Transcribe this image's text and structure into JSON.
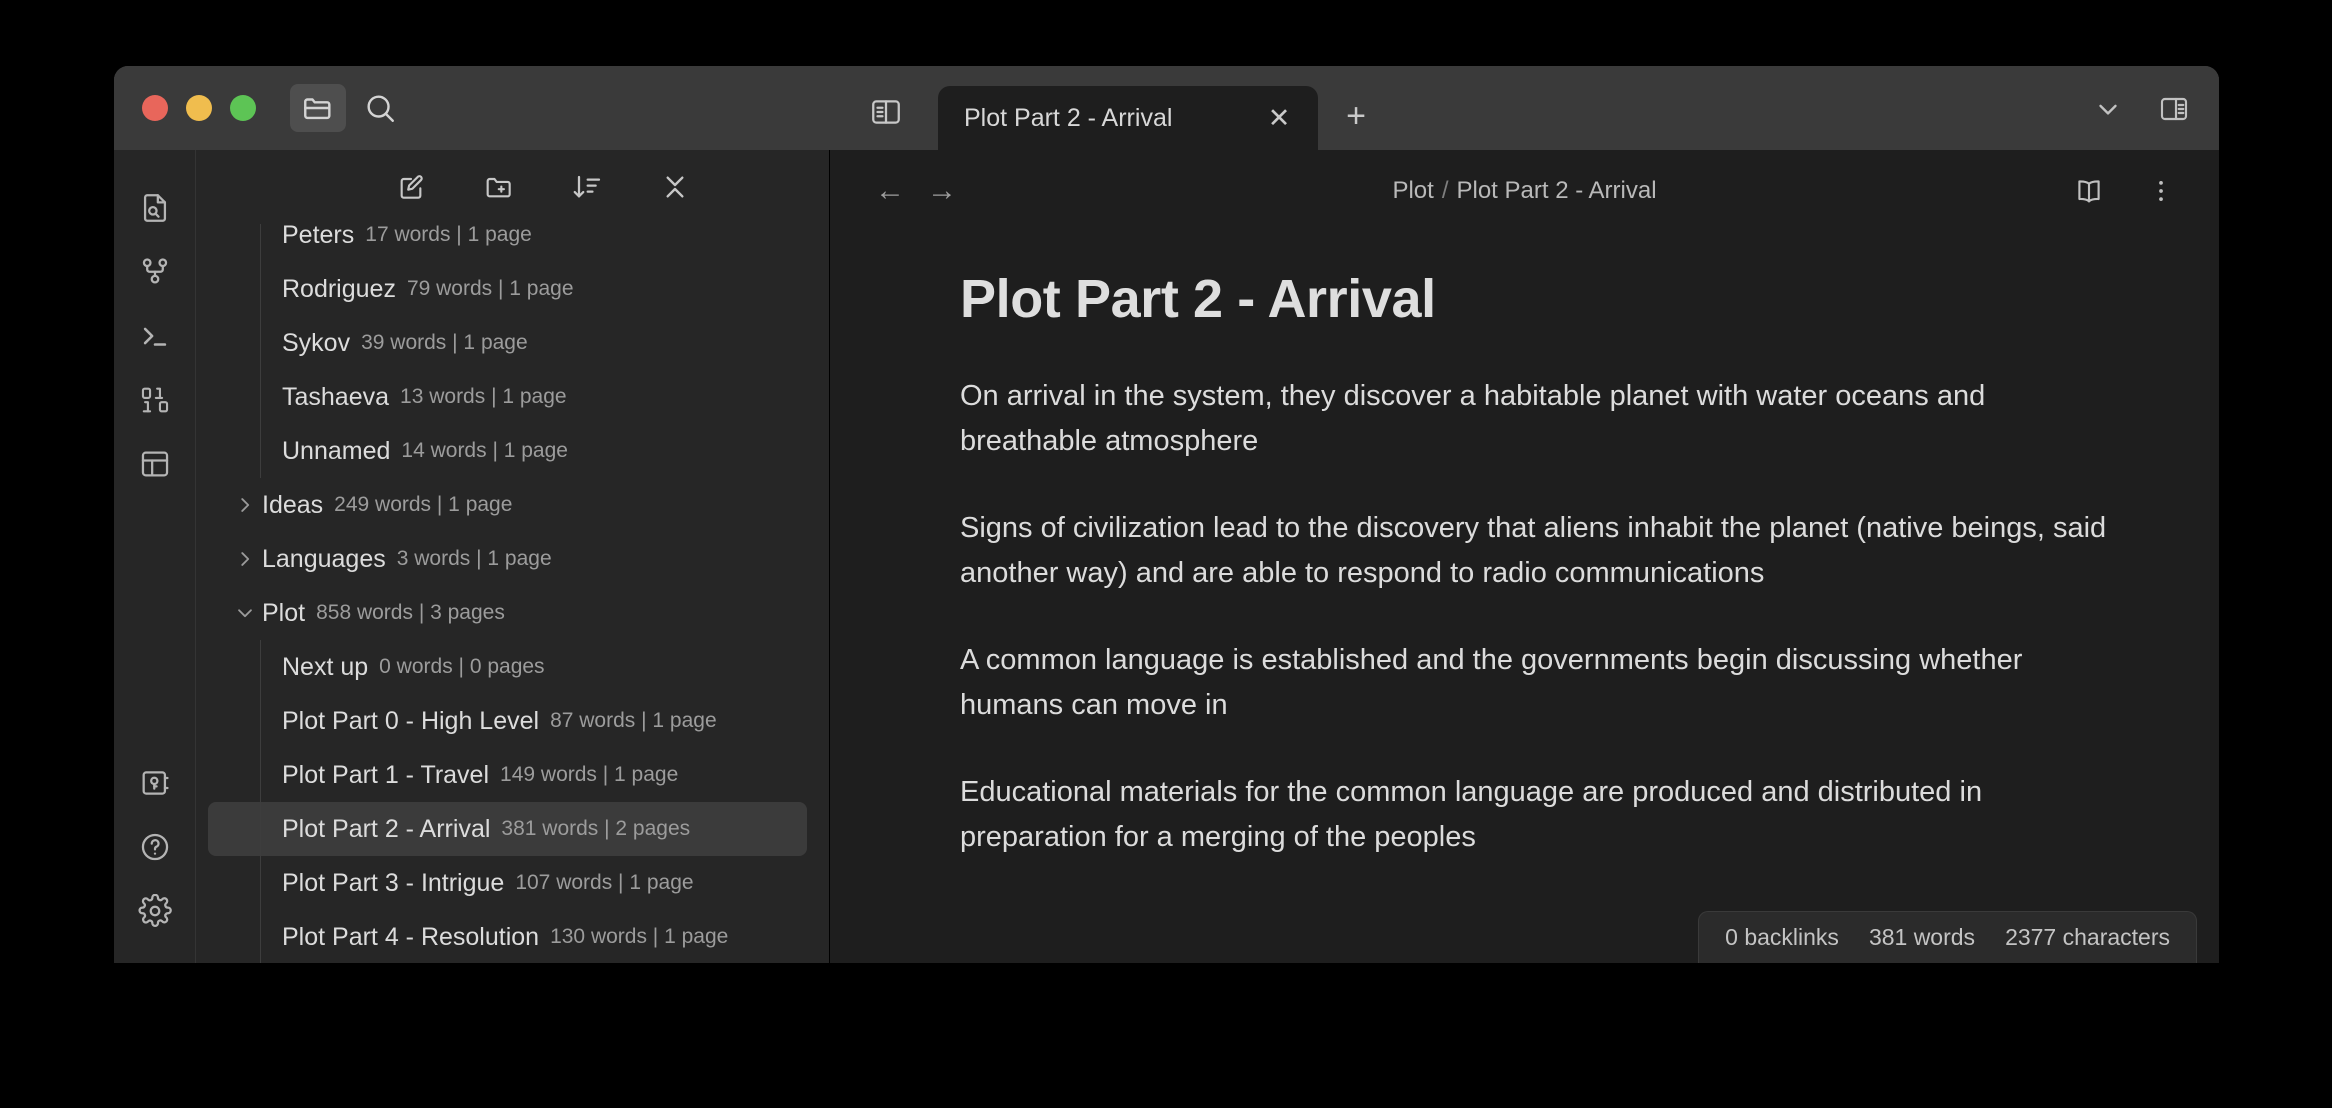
{
  "window": {
    "traffic_lights": [
      "close",
      "minimize",
      "zoom"
    ],
    "colors": {
      "close": "#e8665b",
      "minimize": "#f0bd4e",
      "zoom": "#5dc455",
      "window_bg": "#1e1e1e",
      "topbar_bg": "#3a3a3a",
      "sidebar_bg": "#262626",
      "selection_bg": "#3b3b3b"
    }
  },
  "topbar": {
    "files_button_label": "files-icon",
    "search_button_label": "search-icon",
    "left_sidebar_toggle_label": "toggle-left-sidebar-icon",
    "right_sidebar_toggle_label": "toggle-right-sidebar-icon",
    "tab_list_chevron_label": "chevron-down-icon",
    "new_tab_label": "+",
    "close_tab_label": "✕"
  },
  "tabs": [
    {
      "label": "Plot Part 2 - Arrival",
      "active": true
    }
  ],
  "rail": {
    "top_items": [
      {
        "icon": "file-search-icon",
        "label": "Search in files"
      },
      {
        "icon": "git-branch-icon",
        "label": "Source control"
      },
      {
        "icon": "terminal-icon",
        "label": "Terminal"
      },
      {
        "icon": "binary-icon",
        "label": "Binary"
      },
      {
        "icon": "layout-panel-icon",
        "label": "Layout"
      }
    ],
    "bottom_items": [
      {
        "icon": "vault-key-icon",
        "label": "Vault"
      },
      {
        "icon": "help-circle-icon",
        "label": "Help"
      },
      {
        "icon": "gear-icon",
        "label": "Settings"
      }
    ]
  },
  "sidebar": {
    "toolbar": [
      {
        "icon": "new-note-icon",
        "label": "New note"
      },
      {
        "icon": "new-folder-icon",
        "label": "New folder"
      },
      {
        "icon": "sort-icon",
        "label": "Change sort order"
      },
      {
        "icon": "collapse-all-icon",
        "label": "Collapse all"
      }
    ],
    "tree": [
      {
        "name": "Peters",
        "meta": "17 words | 1 page",
        "indent": 1,
        "chevron": "",
        "selected": false,
        "clipped": true
      },
      {
        "name": "Rodriguez",
        "meta": "79 words | 1 page",
        "indent": 1,
        "chevron": "",
        "selected": false
      },
      {
        "name": "Sykov",
        "meta": "39 words | 1 page",
        "indent": 1,
        "chevron": "",
        "selected": false
      },
      {
        "name": "Tashaeva",
        "meta": "13 words | 1 page",
        "indent": 1,
        "chevron": "",
        "selected": false
      },
      {
        "name": "Unnamed",
        "meta": "14 words | 1 page",
        "indent": 1,
        "chevron": "",
        "selected": false
      },
      {
        "name": "Ideas",
        "meta": "249 words | 1 page",
        "indent": 0,
        "chevron": "right",
        "selected": false
      },
      {
        "name": "Languages",
        "meta": "3 words | 1 page",
        "indent": 0,
        "chevron": "right",
        "selected": false
      },
      {
        "name": "Plot",
        "meta": "858 words | 3 pages",
        "indent": 0,
        "chevron": "down",
        "selected": false
      },
      {
        "name": "Next up",
        "meta": "0 words | 0 pages",
        "indent": 1,
        "chevron": "",
        "selected": false
      },
      {
        "name": "Plot Part 0 - High Level",
        "meta": "87 words | 1 page",
        "indent": 1,
        "chevron": "",
        "selected": false
      },
      {
        "name": "Plot Part 1 - Travel",
        "meta": "149 words | 1 page",
        "indent": 1,
        "chevron": "",
        "selected": false
      },
      {
        "name": "Plot Part 2 - Arrival",
        "meta": "381 words | 2 pages",
        "indent": 1,
        "chevron": "",
        "selected": true
      },
      {
        "name": "Plot Part 3 - Intrigue",
        "meta": "107 words | 1 page",
        "indent": 1,
        "chevron": "",
        "selected": false
      },
      {
        "name": "Plot Part 4 - Resolution",
        "meta": "130 words | 1 page",
        "indent": 1,
        "chevron": "",
        "selected": false
      }
    ]
  },
  "editor": {
    "back_label": "←",
    "forward_label": "→",
    "breadcrumb": {
      "folder": "Plot",
      "separator": "/",
      "note": "Plot Part 2 - Arrival"
    },
    "reading_mode_icon": "book-open-icon",
    "more_menu_icon": "more-vertical-icon",
    "title": "Plot Part 2 - Arrival",
    "paragraphs": [
      "On arrival in the system, they discover a habitable planet with water oceans and breathable atmosphere",
      "Signs of civilization lead to the discovery that aliens inhabit the planet (native beings, said another way) and are able to respond to radio communications",
      "A common language is established and the governments begin discussing whether humans can move in",
      "Educational materials for the common language are produced and distributed in preparation for a merging of the peoples"
    ]
  },
  "statusbar": {
    "backlinks": "0 backlinks",
    "words": "381 words",
    "characters": "2377 characters"
  }
}
